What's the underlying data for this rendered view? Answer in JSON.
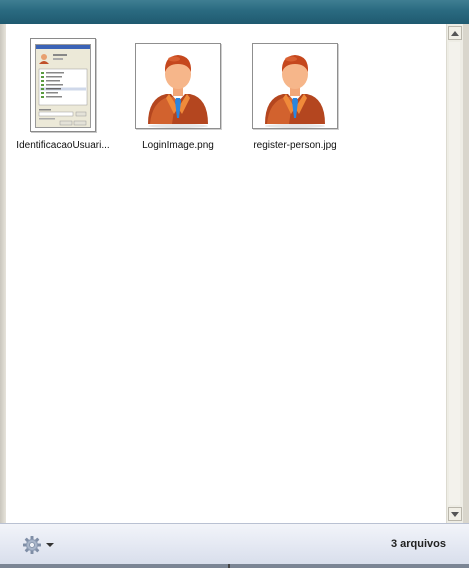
{
  "files": [
    {
      "name": "IdentificacaoUsuari...",
      "type": "screenshot-thumbnail"
    },
    {
      "name": "LoginImage.png",
      "type": "person-image"
    },
    {
      "name": "register-person.jpg",
      "type": "person-image"
    }
  ],
  "status": {
    "count_label": "3 arquivos"
  },
  "toolbar": {
    "settings_icon": "gear-icon",
    "dropdown_icon": "chevron-down-icon"
  },
  "colors": {
    "header": "#2a6a80",
    "status_bar": "#e5e9f3",
    "person_suit": "#c0502a",
    "person_tie": "#2b7fd6"
  }
}
